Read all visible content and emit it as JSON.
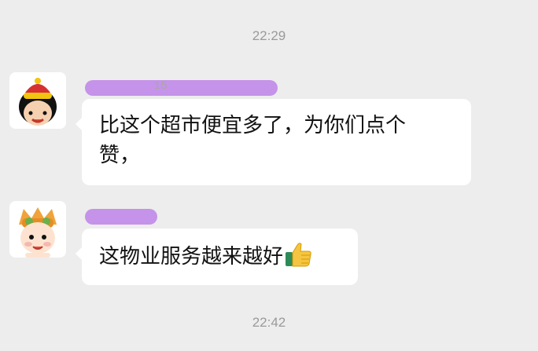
{
  "chat": {
    "timestamps": {
      "top": "22:29",
      "bottom": "22:42"
    },
    "messages": [
      {
        "sender_name_redacted": "15",
        "text_line_1": "比这个超市便宜多了，为你们点个",
        "text_line_2": "赞，",
        "avatar_icon": "cartoon-boy-with-hat-icon"
      },
      {
        "sender_name_redacted": "",
        "text": "这物业服务越来越好",
        "emoji_icon": "thumbs-up-icon",
        "avatar_icon": "cartoon-baby-with-tiger-hat-icon"
      }
    ]
  }
}
